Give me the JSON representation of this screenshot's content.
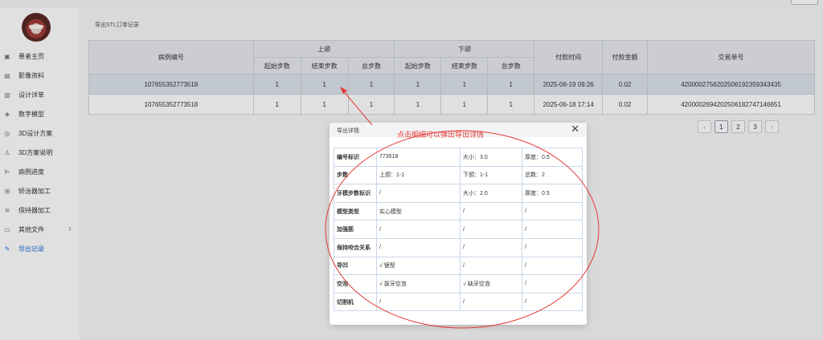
{
  "sidebar": {
    "items": [
      {
        "label": "患者主页",
        "icon": "profile-icon",
        "glyph": "▣"
      },
      {
        "label": "影像资料",
        "icon": "image-icon",
        "glyph": "▤"
      },
      {
        "label": "设计详单",
        "icon": "form-icon",
        "glyph": "▥"
      },
      {
        "label": "数字模型",
        "icon": "model-icon",
        "glyph": "◈"
      },
      {
        "label": "3D设计方案",
        "icon": "cube-icon",
        "glyph": "◎"
      },
      {
        "label": "3D方案说明",
        "icon": "user-icon",
        "glyph": "♙"
      },
      {
        "label": "病例进度",
        "icon": "progress-icon",
        "glyph": "⊫"
      },
      {
        "label": "矫治器加工",
        "icon": "plus-box-icon",
        "glyph": "⊞"
      },
      {
        "label": "保持器加工",
        "icon": "wave-icon",
        "glyph": "≋"
      },
      {
        "label": "其他文件",
        "icon": "folder-icon",
        "glyph": "▭",
        "arrow": "⇕"
      },
      {
        "label": "导出记录",
        "icon": "edit-icon",
        "glyph": "✎",
        "active": true
      }
    ]
  },
  "main": {
    "breadcrumb": "导出STL订单记录",
    "table": {
      "headers": {
        "case_no": "病例编号",
        "upper": "上颌",
        "lower": "下颌",
        "start": "起始步数",
        "end": "结束步数",
        "total": "总步数",
        "pay_time": "付款时间",
        "pay_amount": "付款金额",
        "trade_no": "交易单号"
      },
      "rows": [
        {
          "case_no": "107655352773518",
          "u_start": "1",
          "u_end": "1",
          "u_total": "1",
          "l_start": "1",
          "l_end": "1",
          "l_total": "1",
          "pay_time": "2025-06-19 09:26",
          "pay_amount": "0.02",
          "trade_no": "4200002756202506192359343435"
        },
        {
          "case_no": "107655352773518",
          "u_start": "1",
          "u_end": "1",
          "u_total": "1",
          "l_start": "1",
          "l_end": "1",
          "l_total": "1",
          "pay_time": "2025-06-18 17:14",
          "pay_amount": "0.02",
          "trade_no": "4200002694202506182747146651"
        }
      ]
    },
    "pager": {
      "prev": "‹",
      "pages": [
        "1",
        "2",
        "3"
      ],
      "next": "›"
    }
  },
  "modal": {
    "title": "导出详情",
    "close": "✕",
    "rows": [
      [
        "编号标识",
        "773518",
        "大小：3.0",
        "厚度：0.5"
      ],
      [
        "步数",
        "上颌：1-1",
        "下颌：1-1",
        "总数：2"
      ],
      [
        "牙模步数标识",
        "/",
        "大小：2.0",
        "厚度：0.5"
      ],
      [
        "模型类型",
        "实心模型",
        "/",
        "/"
      ],
      [
        "加强筋",
        "/",
        "/",
        "/"
      ],
      [
        "保持咬合关系",
        "/",
        "/",
        "/"
      ],
      [
        "导凹",
        "√ 锯型",
        "/",
        "/"
      ],
      [
        "空泡",
        "√ 拔牙空泡",
        "√ 缺牙空泡",
        "/"
      ],
      [
        "切割机",
        "/",
        "/",
        "/"
      ]
    ]
  },
  "annotation": {
    "text": "点击明细可以弹出导出详情",
    "color": "#e53935"
  }
}
